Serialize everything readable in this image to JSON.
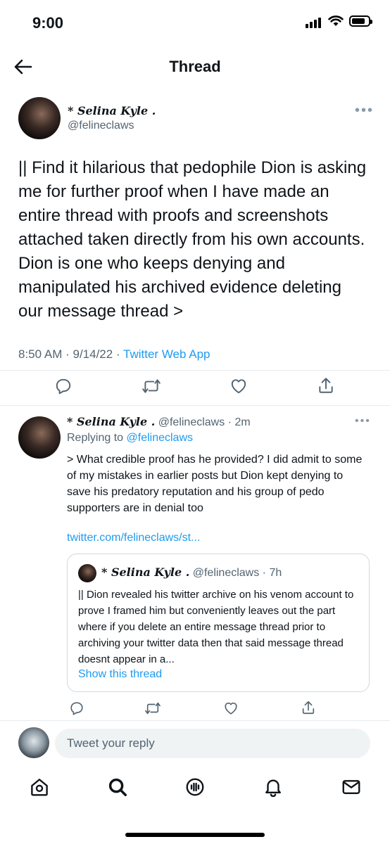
{
  "status_bar": {
    "time": "9:00"
  },
  "header": {
    "title": "Thread"
  },
  "main_tweet": {
    "name": "* Selina Kyle .",
    "handle": "@felineclaws",
    "text": "||  Find it hilarious that pedophile Dion is asking me for further proof when I have made an entire thread with proofs and screenshots attached taken directly from his own accounts. Dion is one who keeps denying and manipulated his archived evidence deleting our message thread >",
    "time": "8:50 AM",
    "date": "9/14/22",
    "source": "Twitter Web App",
    "icons": [
      "reply-icon",
      "retweet-icon",
      "like-icon",
      "share-icon"
    ]
  },
  "reply_tweet": {
    "name": "* Selina Kyle .",
    "handle": "@felineclaws",
    "age": "2m",
    "replying_to_label": "Replying to",
    "replying_to_handle": "@felineclaws",
    "text": ">  What credible proof has he provided? I did admit to some of my mistakes in earlier posts but Dion kept denying to save his predatory reputation and his group of pedo supporters are in denial too",
    "link": "twitter.com/felineclaws/st...",
    "quoted": {
      "name": "* Selina Kyle .",
      "handle": "@felineclaws",
      "age": "7h",
      "text": "|| Dion revealed his twitter archive on his venom account to prove I framed him but conveniently leaves out the part where if you delete an entire message thread prior to archiving your twitter data then that said message thread doesnt appear in a...",
      "show_thread": "Show this thread"
    }
  },
  "composer": {
    "placeholder": "Tweet your reply"
  },
  "tabbar": {
    "items": [
      "home-icon",
      "search-icon",
      "spaces-icon",
      "notifications-icon",
      "messages-icon"
    ]
  },
  "colors": {
    "accent": "#1d9bf0",
    "secondary_text": "#536471",
    "divider": "#e6ecf0"
  }
}
